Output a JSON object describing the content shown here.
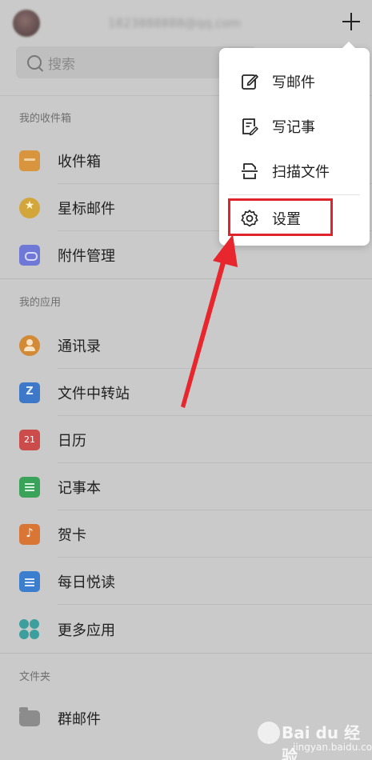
{
  "header": {
    "account_placeholder": "1823888888@qq.com",
    "search_placeholder": "搜索"
  },
  "sections": {
    "mailbox": {
      "label": "我的收件箱",
      "items": [
        {
          "label": "收件箱",
          "icon": "inbox-icon"
        },
        {
          "label": "星标邮件",
          "icon": "star-icon"
        },
        {
          "label": "附件管理",
          "icon": "attachment-icon"
        }
      ]
    },
    "apps": {
      "label": "我的应用",
      "items": [
        {
          "label": "通讯录",
          "icon": "contacts-icon"
        },
        {
          "label": "文件中转站",
          "icon": "file-transfer-icon"
        },
        {
          "label": "日历",
          "icon": "calendar-icon"
        },
        {
          "label": "记事本",
          "icon": "notebook-icon"
        },
        {
          "label": "贺卡",
          "icon": "greeting-card-icon"
        },
        {
          "label": "每日悦读",
          "icon": "daily-reading-icon"
        },
        {
          "label": "更多应用",
          "icon": "more-apps-icon"
        }
      ]
    },
    "folders": {
      "label": "文件夹",
      "items": [
        {
          "label": "群邮件",
          "icon": "folder-icon"
        }
      ]
    }
  },
  "popup_menu": {
    "items": [
      {
        "label": "写邮件",
        "icon": "compose-icon"
      },
      {
        "label": "写记事",
        "icon": "write-note-icon"
      },
      {
        "label": "扫描文件",
        "icon": "scan-icon"
      },
      {
        "label": "设置",
        "icon": "settings-icon"
      }
    ],
    "highlighted": "设置"
  },
  "annotation": {
    "color": "#e0242b"
  },
  "watermark": {
    "main": "Bai du 经验",
    "sub": "jingyan.baidu.com"
  }
}
